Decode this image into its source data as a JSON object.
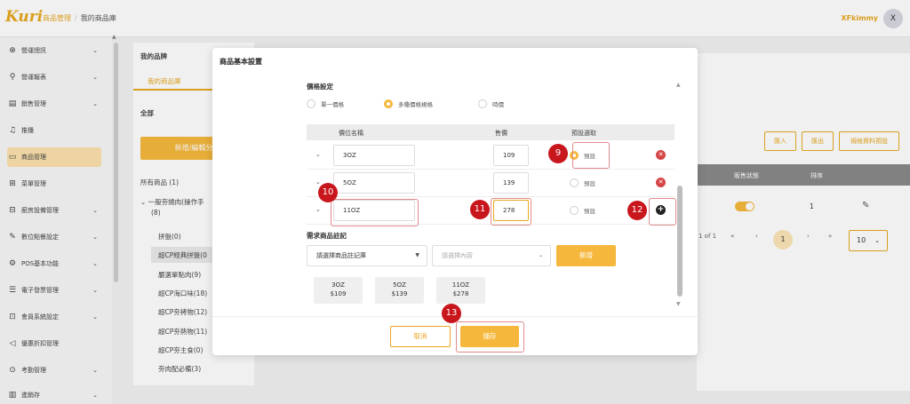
{
  "header": {
    "logo": "Kuri",
    "breadcrumb": [
      "商品管理",
      "我的商品庫"
    ],
    "user": "XFkimmy",
    "avatar_initial": "X"
  },
  "sidebar": {
    "items": [
      {
        "icon": "dashboard-icon",
        "glyph": "⊕",
        "label": "營運總訊"
      },
      {
        "icon": "report-icon",
        "glyph": "⚲",
        "label": "營運報表"
      },
      {
        "icon": "sales-icon",
        "glyph": "▤",
        "label": "銷售管理"
      },
      {
        "icon": "bell-icon",
        "glyph": "♫",
        "label": "推播"
      },
      {
        "icon": "product-icon",
        "glyph": "▭",
        "label": "商品管理"
      },
      {
        "icon": "menu-icon",
        "glyph": "⊞",
        "label": "菜單管理"
      },
      {
        "icon": "kitchen-icon",
        "glyph": "⊟",
        "label": "廚房設備管理"
      },
      {
        "icon": "points-icon",
        "glyph": "✎",
        "label": "數位點餐設定"
      },
      {
        "icon": "pos-icon",
        "glyph": "⚙",
        "label": "POS基本功能"
      },
      {
        "icon": "invoice-icon",
        "glyph": "☰",
        "label": "電子發票管理"
      },
      {
        "icon": "member-icon",
        "glyph": "⊡",
        "label": "會員系統設定"
      },
      {
        "icon": "coupon-icon",
        "glyph": "◁",
        "label": "優惠折扣管理"
      },
      {
        "icon": "attendance-icon",
        "glyph": "⊙",
        "label": "考勤管理"
      },
      {
        "icon": "analytics-icon",
        "glyph": "▥",
        "label": "進銷存"
      }
    ]
  },
  "panel": {
    "brand_label": "我的品牌",
    "tab_label": "我的商品庫",
    "all_label": "全部",
    "new_button": "新增/編輯分",
    "all_products": "所有商品 (1)",
    "group_label": "一般夯燒肉(操作手",
    "group_count": "(8)",
    "categories": [
      "拼盤(0)",
      "超CP經典拼盤(0",
      "嚴選單點肉(9)",
      "超CP海口味(18)",
      "超CP夯拷物(12)",
      "超CP夯熱物(11)",
      "超CP夯主食(0)",
      "夯肉配必備(3)"
    ]
  },
  "right": {
    "buttons": [
      "匯入",
      "匯出",
      "規格資料預設"
    ],
    "col_status": "販售狀態",
    "col_order": "排序",
    "row_order": "1",
    "pager_of": "1 of 1",
    "pager_first": "«",
    "pager_prev": "‹",
    "pager_current": "1",
    "pager_next": "›",
    "pager_last": "»",
    "page_size": "10"
  },
  "modal": {
    "title": "商品基本設置",
    "price_section": "價格設定",
    "price_options": [
      "單一價格",
      "多種價格規格",
      "時價"
    ],
    "col_name": "價位名稱",
    "col_price": "售價",
    "col_default": "預設選取",
    "rows": [
      {
        "name": "3OZ",
        "price": "109",
        "default_label": "預設"
      },
      {
        "name": "5OZ",
        "price": "139",
        "default_label": "預設"
      },
      {
        "name": "11OZ",
        "price": "278",
        "default_label": "預設"
      }
    ],
    "note_section": "需求商品註記",
    "note_select": "請選擇商品註記庫",
    "content_select": "請選擇內容",
    "add_label": "新增",
    "chips": [
      {
        "name": "3OZ",
        "price": "$109"
      },
      {
        "name": "5OZ",
        "price": "$139"
      },
      {
        "name": "11OZ",
        "price": "$278"
      }
    ],
    "cancel_label": "取消",
    "save_label": "儲存"
  },
  "annotations": [
    "9",
    "10",
    "11",
    "12",
    "13"
  ],
  "colors": {
    "accent": "#f5b83d",
    "badge": "#c8161d",
    "delete": "#d64545"
  }
}
